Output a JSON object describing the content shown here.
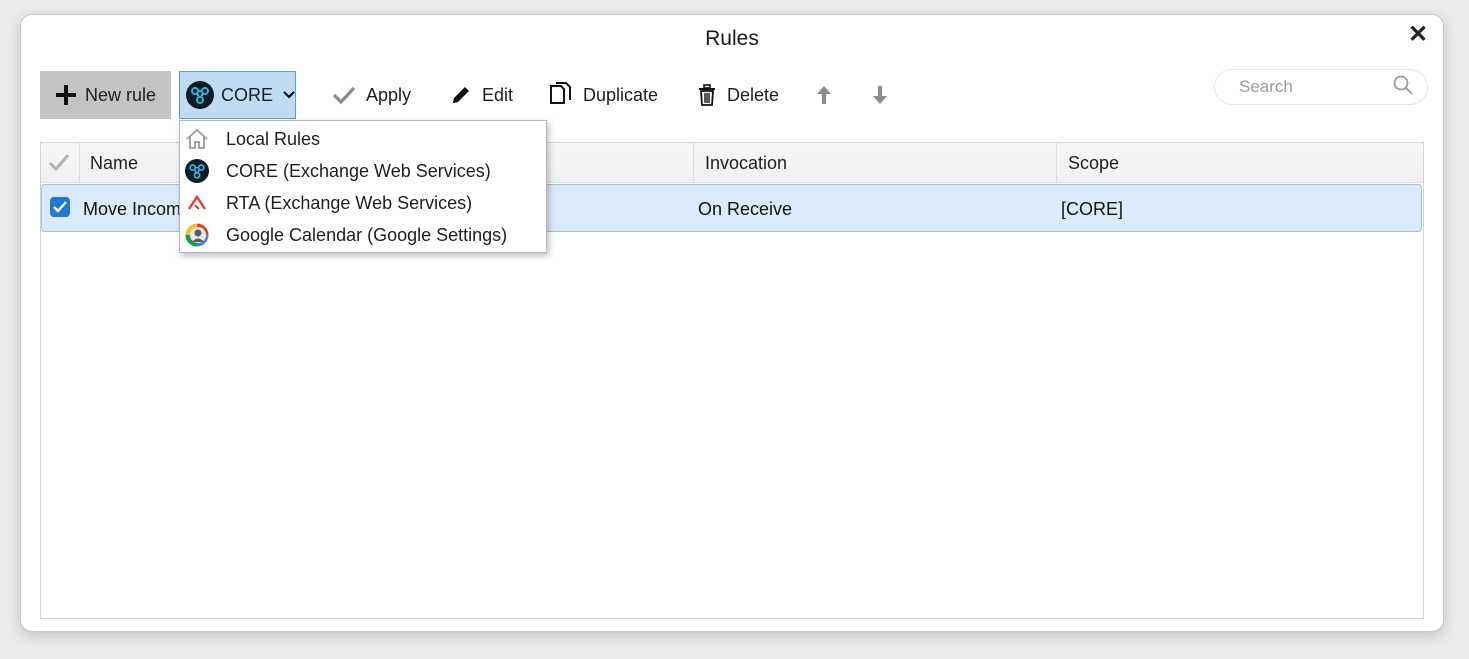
{
  "window": {
    "title": "Rules",
    "close_symbol": "✕"
  },
  "toolbar": {
    "new_rule_label": "New rule",
    "account_label": "CORE",
    "apply_label": "Apply",
    "edit_label": "Edit",
    "duplicate_label": "Duplicate",
    "delete_label": "Delete"
  },
  "search": {
    "placeholder": "Search",
    "value": ""
  },
  "table": {
    "columns": [
      "Name",
      "Invocation",
      "Scope"
    ],
    "rows": [
      {
        "checked": true,
        "name": "Move Incom",
        "invocation": "On Receive",
        "scope": "[CORE]"
      }
    ]
  },
  "account_menu": {
    "items": [
      {
        "label": "Local Rules",
        "icon": "home-icon"
      },
      {
        "label": "CORE (Exchange Web Services)",
        "icon": "core-account-icon"
      },
      {
        "label": "RTA (Exchange Web Services)",
        "icon": "rta-account-icon"
      },
      {
        "label": "Google Calendar (Google Settings)",
        "icon": "google-account-avatar-icon"
      }
    ]
  },
  "colors": {
    "selected_row": "#dcebfb",
    "checkbox": "#1f78d1",
    "account_button": "#bfdcf5",
    "core_icon_bg": "#0d1b26",
    "core_icon_fg": "#2fb5d8",
    "rta_icon": "#e23b3b"
  }
}
